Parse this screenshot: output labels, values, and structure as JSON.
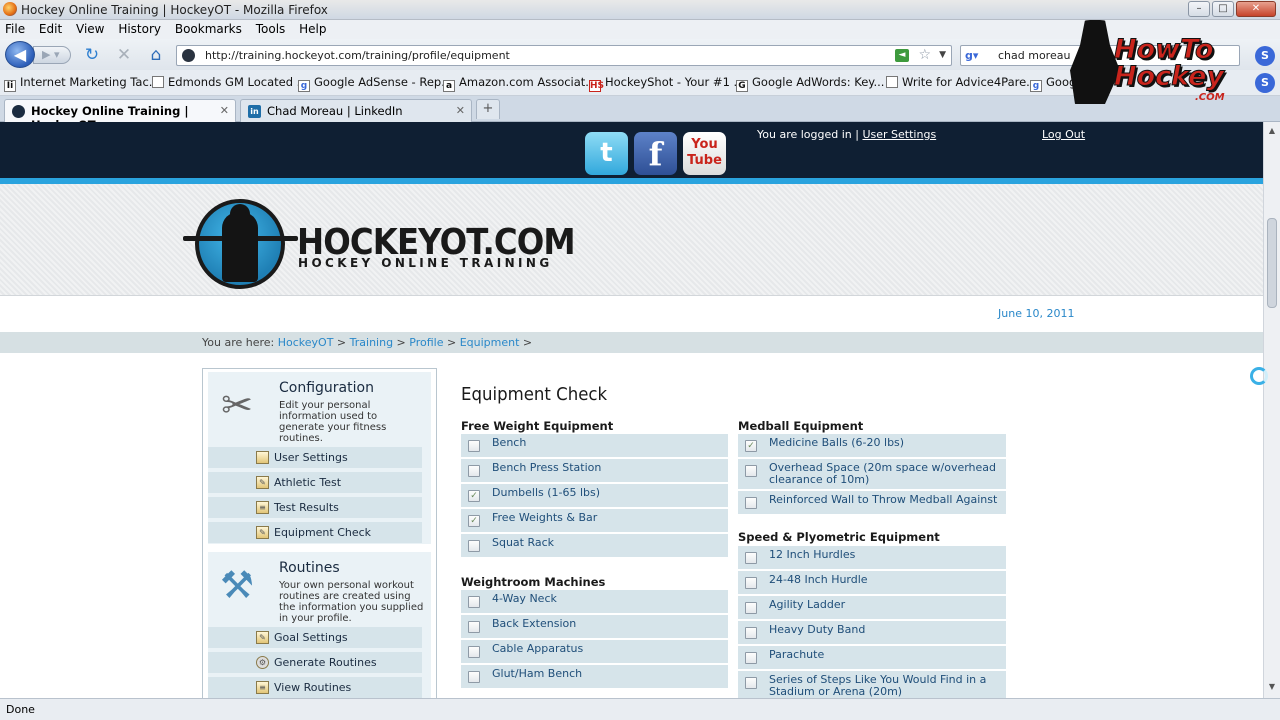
{
  "window": {
    "title": "Hockey Online Training | HockeyOT - Mozilla Firefox"
  },
  "menu": [
    "File",
    "Edit",
    "View",
    "History",
    "Bookmarks",
    "Tools",
    "Help"
  ],
  "nav": {
    "url": "http://training.hockeyot.com/training/profile/equipment",
    "search_value": "chad moreau"
  },
  "bookmarks": [
    "Internet Marketing Tac...",
    "Edmonds GM Located ...",
    "Google AdSense - Rep...",
    "Amazon.com Associat...",
    "HockeyShot - Your #1 ...",
    "Google AdWords: Key...",
    "Write for Advice4Pare...",
    "Google Tr"
  ],
  "tabs": [
    {
      "label": "Hockey Online Training | HockeyOT"
    },
    {
      "label": "Chad Moreau | LinkedIn"
    }
  ],
  "site": {
    "logged_in_text": "You are logged in |",
    "user_settings": "User Settings",
    "logout": "Log Out",
    "logo": "HOCKEYOT.COM",
    "logo_sub": "HOCKEY ONLINE TRAINING",
    "date": "June 10, 2011",
    "breadcrumb_label": "You are here:",
    "breadcrumbs": [
      "HockeyOT",
      "Training",
      "Profile",
      "Equipment"
    ]
  },
  "sidebar": {
    "configuration": {
      "title": "Configuration",
      "desc": "Edit your personal information used to generate your fitness routines.",
      "items": [
        "User Settings",
        "Athletic Test",
        "Test Results",
        "Equipment Check"
      ]
    },
    "routines": {
      "title": "Routines",
      "desc": "Your own personal workout routines are created using the information you supplied in your profile.",
      "items": [
        "Goal Settings",
        "Generate Routines",
        "View Routines"
      ]
    }
  },
  "equipment": {
    "title": "Equipment Check",
    "free_weight": {
      "heading": "Free Weight Equipment",
      "items": [
        {
          "label": "Bench",
          "checked": false
        },
        {
          "label": "Bench Press Station",
          "checked": false
        },
        {
          "label": "Dumbells (1-65 lbs)",
          "checked": true
        },
        {
          "label": "Free Weights & Bar",
          "checked": true
        },
        {
          "label": "Squat Rack",
          "checked": false
        }
      ]
    },
    "weightroom": {
      "heading": "Weightroom Machines",
      "items": [
        {
          "label": "4-Way Neck",
          "checked": false
        },
        {
          "label": "Back Extension",
          "checked": false
        },
        {
          "label": "Cable Apparatus",
          "checked": false
        },
        {
          "label": "Glut/Ham Bench",
          "checked": false
        }
      ]
    },
    "medball": {
      "heading": "Medball Equipment",
      "items": [
        {
          "label": "Medicine Balls (6-20 lbs)",
          "checked": true
        },
        {
          "label": "Overhead Space (20m space w/overhead clearance of 10m)",
          "checked": false
        },
        {
          "label": "Reinforced Wall to Throw Medball Against",
          "checked": false
        }
      ]
    },
    "speed": {
      "heading": "Speed & Plyometric Equipment",
      "items": [
        {
          "label": "12 Inch Hurdles",
          "checked": false
        },
        {
          "label": "24-48 Inch Hurdle",
          "checked": false
        },
        {
          "label": "Agility Ladder",
          "checked": false
        },
        {
          "label": "Heavy Duty Band",
          "checked": false
        },
        {
          "label": "Parachute",
          "checked": false
        },
        {
          "label": "Series of Steps Like You Would Find in a Stadium or Arena (20m)",
          "checked": false
        }
      ]
    }
  },
  "watermark": {
    "text": "HowTo Hockey",
    "com": ".COM"
  },
  "status": "Done"
}
